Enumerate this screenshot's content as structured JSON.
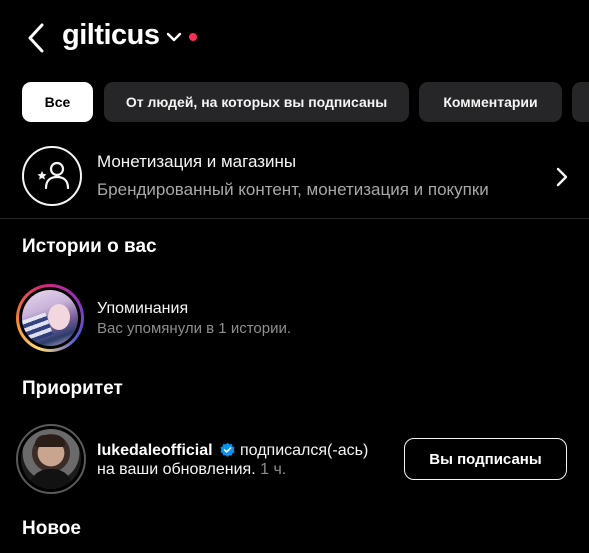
{
  "header": {
    "username": "gilticus"
  },
  "filters": [
    {
      "label": "Все",
      "active": true
    },
    {
      "label": "От людей, на которых вы подписаны",
      "active": false
    },
    {
      "label": "Комментарии",
      "active": false
    },
    {
      "label": "",
      "active": false
    }
  ],
  "monetization": {
    "title": "Монетизация и магазины",
    "subtitle": "Брендированный контент, монетизация и покупки"
  },
  "sections": {
    "stories_title": "Истории о вас",
    "priority_title": "Приоритет",
    "new_title": "Новое"
  },
  "story_mention": {
    "title": "Упоминания",
    "subtitle": "Вас упомянули в 1 истории."
  },
  "priority_item": {
    "username": "lukedaleofficial",
    "action": "подписался(-ась)",
    "line2": "на ваши обновления.",
    "time": "1 ч.",
    "button_label": "Вы подписаны"
  },
  "colors": {
    "background": "#000000",
    "chip": "#262628",
    "chip_active": "#ffffff",
    "notification_dot": "#ff2d55",
    "verified_badge": "#0095f6",
    "secondary_text": "#8e8e8e"
  }
}
